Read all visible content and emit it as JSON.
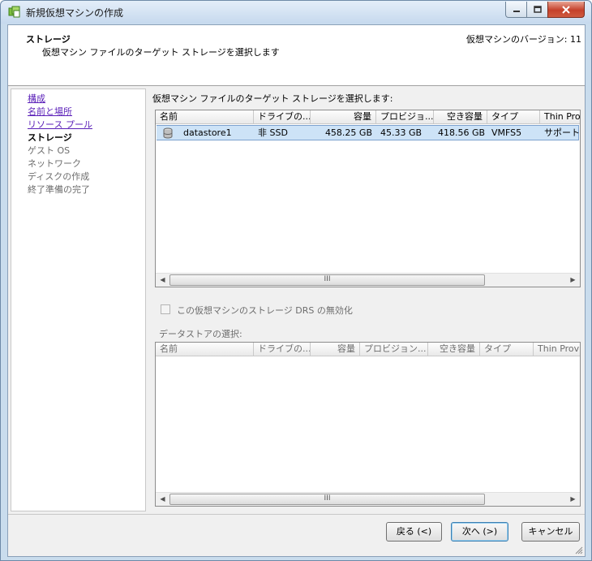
{
  "window": {
    "title": "新規仮想マシンの作成"
  },
  "header": {
    "title": "ストレージ",
    "subtitle": "仮想マシン ファイルのターゲット ストレージを選択します",
    "version": "仮想マシンのバージョン: 11"
  },
  "steps": [
    {
      "label": "構成",
      "state": "link"
    },
    {
      "label": "名前と場所",
      "state": "link"
    },
    {
      "label": "リソース プール",
      "state": "link"
    },
    {
      "label": "ストレージ",
      "state": "current"
    },
    {
      "label": "ゲスト OS",
      "state": "disabled"
    },
    {
      "label": "ネットワーク",
      "state": "disabled"
    },
    {
      "label": "ディスクの作成",
      "state": "disabled"
    },
    {
      "label": "終了準備の完了",
      "state": "disabled"
    }
  ],
  "main": {
    "label": "仮想マシン ファイルのターゲット ストレージを選択します:"
  },
  "storage_table": {
    "columns": [
      "名前",
      "ドライブの...",
      "容量",
      "プロビジョ...",
      "空き容量",
      "タイプ",
      "Thin Prov"
    ],
    "rows": [
      {
        "name": "datastore1",
        "drive": "非 SSD",
        "capacity": "458.25 GB",
        "provisioned": "45.33 GB",
        "free": "418.56 GB",
        "type": "VMFS5",
        "thin": "サポート対"
      }
    ],
    "scroll_thumb": "III"
  },
  "drs_checkbox": {
    "label": "この仮想マシンのストレージ DRS の無効化",
    "checked": false
  },
  "datastore_select": {
    "label": "データストアの選択:",
    "columns": [
      "名前",
      "ドライブの...",
      "容量",
      "プロビジョン...",
      "空き容量",
      "タイプ",
      "Thin Provi"
    ],
    "scroll_thumb": "III"
  },
  "buttons": {
    "back": "戻る (<)",
    "next": "次へ (>)",
    "cancel": "キャンセル"
  },
  "colors": {
    "selection": "#cde3f7",
    "link": "#5a1fb8",
    "close_button": "#c5412b"
  }
}
